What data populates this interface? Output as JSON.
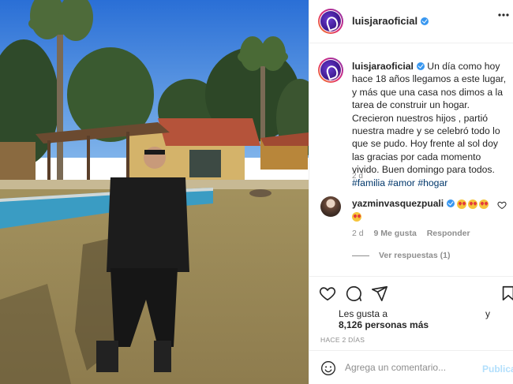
{
  "post": {
    "username": "luisjaraoficial",
    "caption_text": " Un día como hoy hace 18 años llegamos a este lugar, y más que una casa nos dimos a la tarea de construir un hogar. Crecieron nuestros hijos , partió nuestra madre y se celebró todo lo que se pudo. Hoy frente al sol doy las gracias por cada momento vivido. Buen domingo para todos. ",
    "hashtags": [
      "#familia",
      "#amor",
      "#hogar"
    ],
    "caption_time": "2 d"
  },
  "comment": {
    "username": "yazminvasquezpuali",
    "time": "2 d",
    "likes": "9 Me gusta",
    "reply_label": "Responder",
    "view_replies": "Ver respuestas (1)"
  },
  "likes": {
    "prefix": "Les gusta a",
    "suffix": "y",
    "count": "8,126 personas más"
  },
  "timestamp": "HACE 2 DÍAS",
  "composer": {
    "placeholder": "Agrega un comentario...",
    "post_label": "Publicar"
  },
  "icons": [
    "more-options-icon",
    "verified-badge-icon",
    "heart-icon",
    "comment-icon",
    "share-icon",
    "bookmark-icon",
    "emoji-icon"
  ],
  "colors": {
    "link": "#00376b",
    "verified": "#3897f0",
    "muted": "#8e8e8e",
    "post_disabled": "#b2dffc"
  }
}
